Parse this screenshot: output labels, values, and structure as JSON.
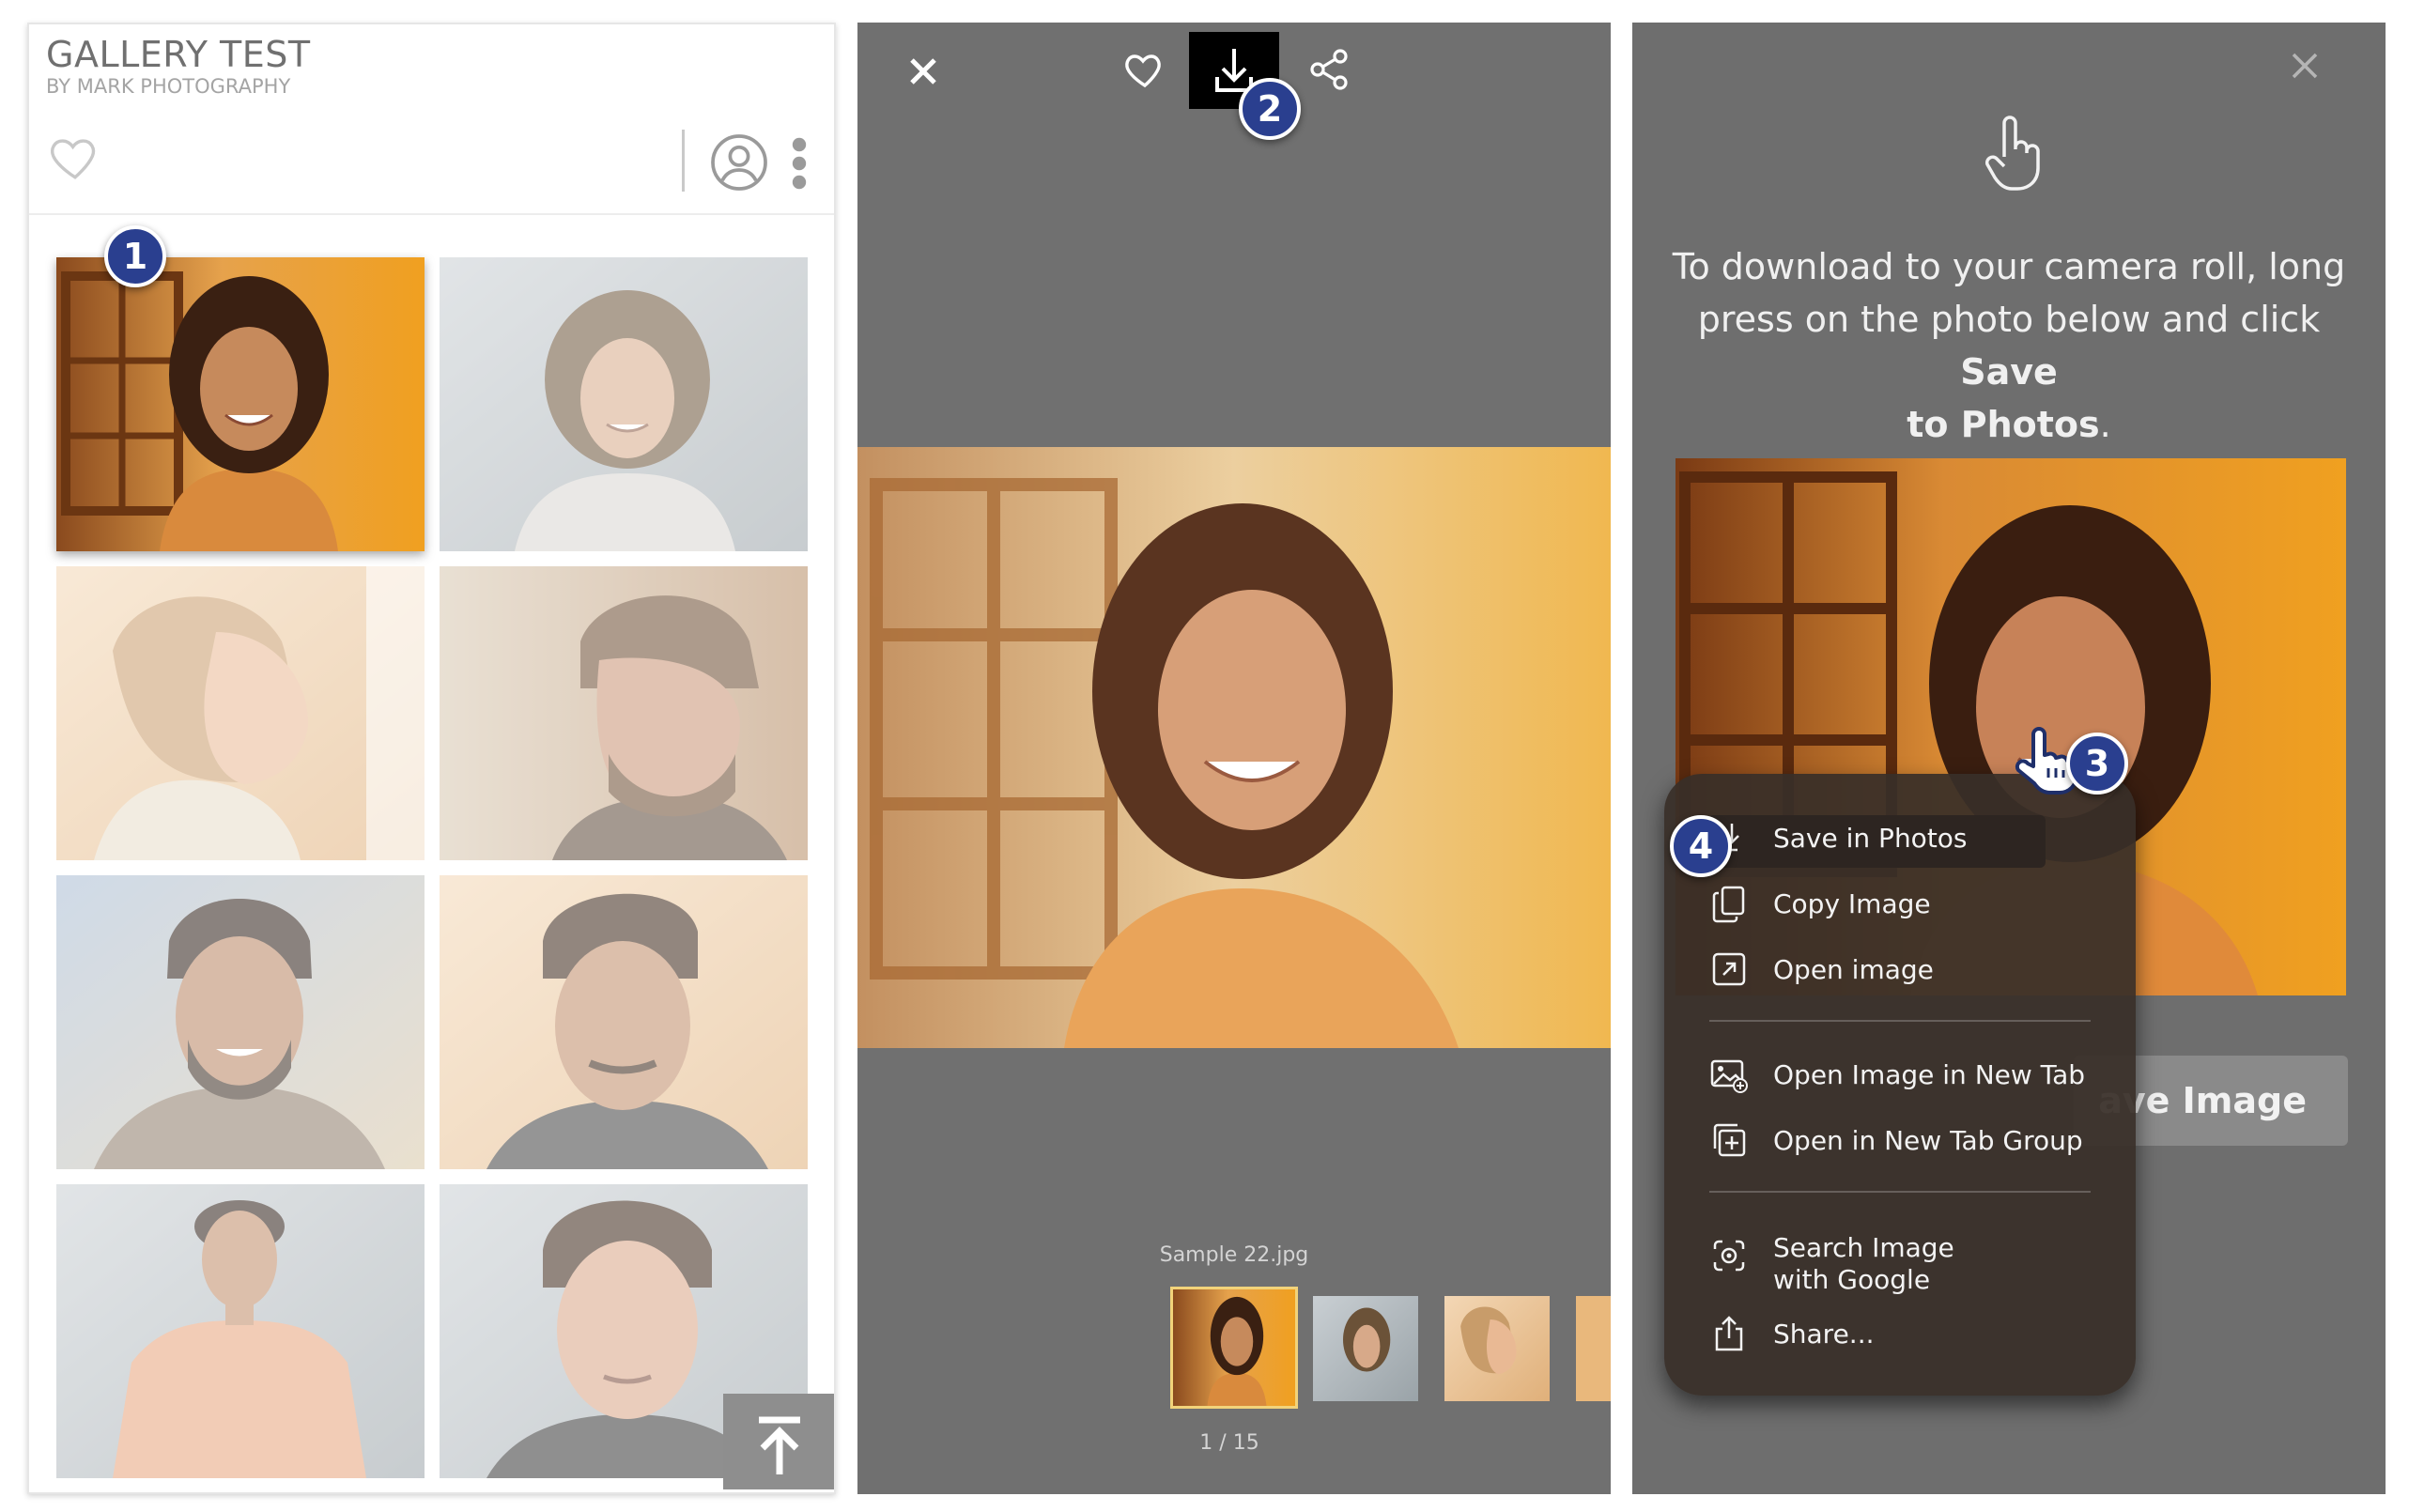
{
  "gallery": {
    "title": "GALLERY TEST",
    "subtitle": "BY MARK PHOTOGRAPHY",
    "favorite_icon": "heart-outline-icon",
    "account_icon": "user-circle-icon",
    "more_icon": "kebab-menu-icon",
    "scroll_top_icon": "arrow-to-top-icon",
    "thumbnails": [
      {
        "label": "woman-curly-hair-window"
      },
      {
        "label": "woman-wavy-hair-grey-sweater"
      },
      {
        "label": "woman-profile-blonde"
      },
      {
        "label": "man-beard-side-profile"
      },
      {
        "label": "man-curly-hair-sweater"
      },
      {
        "label": "man-pompadour-fade"
      },
      {
        "label": "man-peach-shirt-full-body"
      },
      {
        "label": "man-dark-tshirt-grey-bg"
      }
    ]
  },
  "viewer": {
    "close_icon": "close-x-icon",
    "favorite_icon": "heart-outline-icon",
    "download_icon": "download-tray-icon",
    "share_icon": "share-nodes-icon",
    "file_name": "Sample 22.jpg",
    "counter": "1 / 15"
  },
  "download_help": {
    "close_icon": "close-x-icon",
    "hand_icon": "tap-hand-icon",
    "instruction_prefix": "To download to your camera roll, long press on the photo below and click ",
    "instruction_bold_1": "Save",
    "instruction_bold_2": "to Photos",
    "instruction_suffix": ".",
    "save_button_label": "ave Image",
    "context_menu": {
      "group1": [
        {
          "label": "Save in Photos",
          "icon": "save-download-icon"
        },
        {
          "label": "Copy Image",
          "icon": "copy-doc-icon"
        },
        {
          "label": "Open image",
          "icon": "open-external-icon"
        }
      ],
      "group2": [
        {
          "label": "Open Image in New Tab",
          "icon": "image-plus-icon"
        },
        {
          "label": "Open in New Tab Group",
          "icon": "tab-group-icon"
        }
      ],
      "group3": [
        {
          "label_line1": "Search Image",
          "label_line2": "with Google",
          "icon": "lens-search-icon"
        },
        {
          "label": "Share...",
          "icon": "share-up-icon"
        }
      ]
    }
  },
  "steps": [
    "1",
    "2",
    "3",
    "4"
  ],
  "colors": {
    "badge": "#2a3f8f",
    "viewer_bg": "#707070",
    "menu_bg": "#382e28",
    "download_bg": "#000000"
  }
}
